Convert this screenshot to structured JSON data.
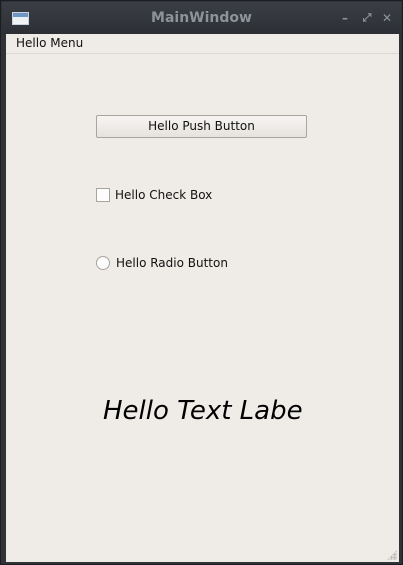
{
  "window": {
    "title": "MainWindow",
    "controls": {
      "minimize_glyph": "–",
      "maximize_glyph": "⤢",
      "close_glyph": "✕"
    },
    "app_icon": "window-app-icon"
  },
  "menubar": {
    "items": [
      {
        "label": "Hello Menu"
      }
    ]
  },
  "content": {
    "push_button_label": "Hello Push Button",
    "check_box_label": "Hello Check Box",
    "check_box_checked": false,
    "radio_button_label": "Hello Radio Button",
    "radio_button_selected": false,
    "text_label": "Hello Text Label"
  },
  "colors": {
    "client_background": "#efebe7",
    "titlebar": "#2f3237",
    "title_text": "#8d939b"
  }
}
